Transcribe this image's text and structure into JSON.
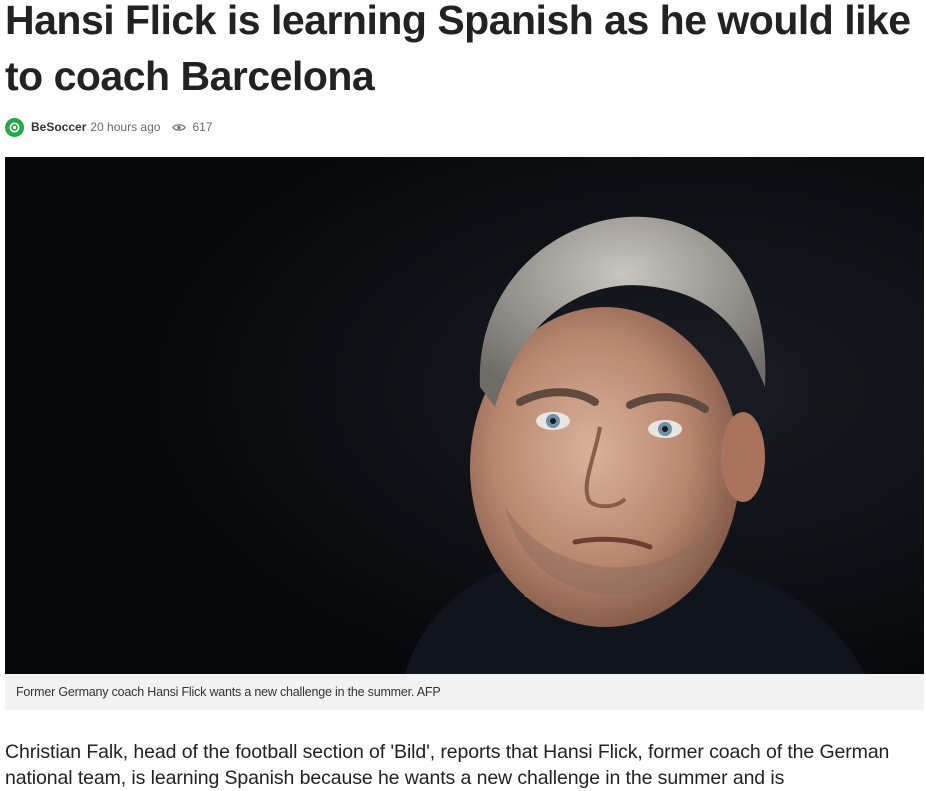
{
  "article": {
    "title": "Hansi Flick is learning Spanish as he would like to coach Barcelona",
    "source": "BeSoccer",
    "time_ago": "20 hours ago",
    "views": "617",
    "caption": "Former Germany coach Hansi Flick wants a new challenge in the summer. AFP",
    "body": "Christian Falk, head of the football section of 'Bild', reports that Hansi Flick, former coach of the German national team, is learning Spanish because he wants a new challenge in the summer and is"
  },
  "icons": {
    "source_logo": "besoccer-logo-icon",
    "views": "eye-icon"
  },
  "colors": {
    "brand_green": "#27a745",
    "photo_background": "#0b0c10",
    "caption_background": "#f2f2f2"
  }
}
